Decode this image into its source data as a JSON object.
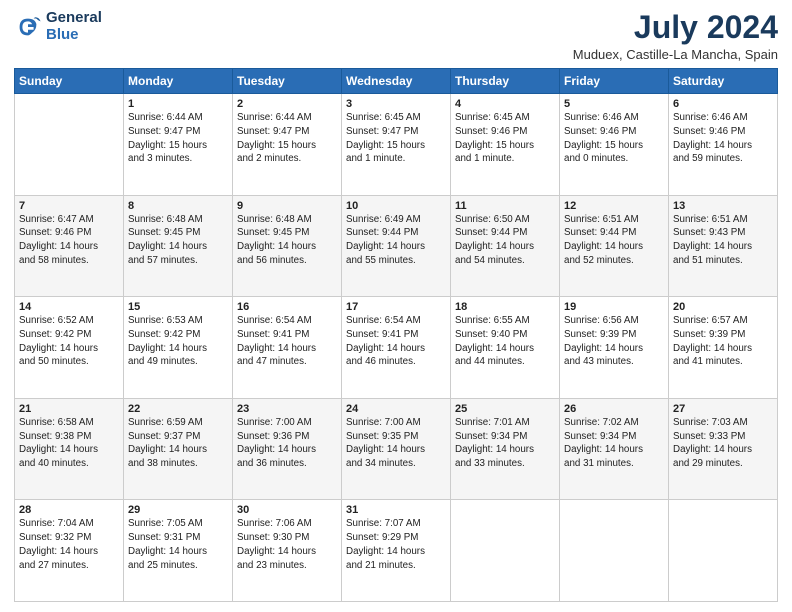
{
  "logo": {
    "line1": "General",
    "line2": "Blue"
  },
  "title": "July 2024",
  "subtitle": "Muduex, Castille-La Mancha, Spain",
  "weekdays": [
    "Sunday",
    "Monday",
    "Tuesday",
    "Wednesday",
    "Thursday",
    "Friday",
    "Saturday"
  ],
  "weeks": [
    [
      {
        "day": "",
        "info": ""
      },
      {
        "day": "1",
        "info": "Sunrise: 6:44 AM\nSunset: 9:47 PM\nDaylight: 15 hours\nand 3 minutes."
      },
      {
        "day": "2",
        "info": "Sunrise: 6:44 AM\nSunset: 9:47 PM\nDaylight: 15 hours\nand 2 minutes."
      },
      {
        "day": "3",
        "info": "Sunrise: 6:45 AM\nSunset: 9:47 PM\nDaylight: 15 hours\nand 1 minute."
      },
      {
        "day": "4",
        "info": "Sunrise: 6:45 AM\nSunset: 9:46 PM\nDaylight: 15 hours\nand 1 minute."
      },
      {
        "day": "5",
        "info": "Sunrise: 6:46 AM\nSunset: 9:46 PM\nDaylight: 15 hours\nand 0 minutes."
      },
      {
        "day": "6",
        "info": "Sunrise: 6:46 AM\nSunset: 9:46 PM\nDaylight: 14 hours\nand 59 minutes."
      }
    ],
    [
      {
        "day": "7",
        "info": "Sunrise: 6:47 AM\nSunset: 9:46 PM\nDaylight: 14 hours\nand 58 minutes."
      },
      {
        "day": "8",
        "info": "Sunrise: 6:48 AM\nSunset: 9:45 PM\nDaylight: 14 hours\nand 57 minutes."
      },
      {
        "day": "9",
        "info": "Sunrise: 6:48 AM\nSunset: 9:45 PM\nDaylight: 14 hours\nand 56 minutes."
      },
      {
        "day": "10",
        "info": "Sunrise: 6:49 AM\nSunset: 9:44 PM\nDaylight: 14 hours\nand 55 minutes."
      },
      {
        "day": "11",
        "info": "Sunrise: 6:50 AM\nSunset: 9:44 PM\nDaylight: 14 hours\nand 54 minutes."
      },
      {
        "day": "12",
        "info": "Sunrise: 6:51 AM\nSunset: 9:44 PM\nDaylight: 14 hours\nand 52 minutes."
      },
      {
        "day": "13",
        "info": "Sunrise: 6:51 AM\nSunset: 9:43 PM\nDaylight: 14 hours\nand 51 minutes."
      }
    ],
    [
      {
        "day": "14",
        "info": "Sunrise: 6:52 AM\nSunset: 9:42 PM\nDaylight: 14 hours\nand 50 minutes."
      },
      {
        "day": "15",
        "info": "Sunrise: 6:53 AM\nSunset: 9:42 PM\nDaylight: 14 hours\nand 49 minutes."
      },
      {
        "day": "16",
        "info": "Sunrise: 6:54 AM\nSunset: 9:41 PM\nDaylight: 14 hours\nand 47 minutes."
      },
      {
        "day": "17",
        "info": "Sunrise: 6:54 AM\nSunset: 9:41 PM\nDaylight: 14 hours\nand 46 minutes."
      },
      {
        "day": "18",
        "info": "Sunrise: 6:55 AM\nSunset: 9:40 PM\nDaylight: 14 hours\nand 44 minutes."
      },
      {
        "day": "19",
        "info": "Sunrise: 6:56 AM\nSunset: 9:39 PM\nDaylight: 14 hours\nand 43 minutes."
      },
      {
        "day": "20",
        "info": "Sunrise: 6:57 AM\nSunset: 9:39 PM\nDaylight: 14 hours\nand 41 minutes."
      }
    ],
    [
      {
        "day": "21",
        "info": "Sunrise: 6:58 AM\nSunset: 9:38 PM\nDaylight: 14 hours\nand 40 minutes."
      },
      {
        "day": "22",
        "info": "Sunrise: 6:59 AM\nSunset: 9:37 PM\nDaylight: 14 hours\nand 38 minutes."
      },
      {
        "day": "23",
        "info": "Sunrise: 7:00 AM\nSunset: 9:36 PM\nDaylight: 14 hours\nand 36 minutes."
      },
      {
        "day": "24",
        "info": "Sunrise: 7:00 AM\nSunset: 9:35 PM\nDaylight: 14 hours\nand 34 minutes."
      },
      {
        "day": "25",
        "info": "Sunrise: 7:01 AM\nSunset: 9:34 PM\nDaylight: 14 hours\nand 33 minutes."
      },
      {
        "day": "26",
        "info": "Sunrise: 7:02 AM\nSunset: 9:34 PM\nDaylight: 14 hours\nand 31 minutes."
      },
      {
        "day": "27",
        "info": "Sunrise: 7:03 AM\nSunset: 9:33 PM\nDaylight: 14 hours\nand 29 minutes."
      }
    ],
    [
      {
        "day": "28",
        "info": "Sunrise: 7:04 AM\nSunset: 9:32 PM\nDaylight: 14 hours\nand 27 minutes."
      },
      {
        "day": "29",
        "info": "Sunrise: 7:05 AM\nSunset: 9:31 PM\nDaylight: 14 hours\nand 25 minutes."
      },
      {
        "day": "30",
        "info": "Sunrise: 7:06 AM\nSunset: 9:30 PM\nDaylight: 14 hours\nand 23 minutes."
      },
      {
        "day": "31",
        "info": "Sunrise: 7:07 AM\nSunset: 9:29 PM\nDaylight: 14 hours\nand 21 minutes."
      },
      {
        "day": "",
        "info": ""
      },
      {
        "day": "",
        "info": ""
      },
      {
        "day": "",
        "info": ""
      }
    ]
  ]
}
